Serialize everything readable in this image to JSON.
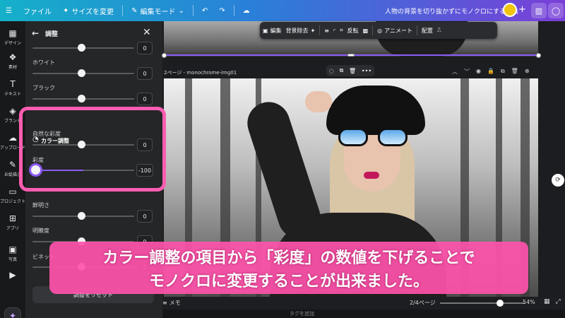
{
  "topbar": {
    "menu_icon": "hamburger-icon",
    "file_label": "ファイル",
    "resize_label": "サイズを変更",
    "edit_mode_label": "編集モード",
    "doc_title": "人物の背景を切り抜かずにモノクロにする方法"
  },
  "rail": {
    "items": [
      {
        "label": "デザイン",
        "icon": "design-icon"
      },
      {
        "label": "素材",
        "icon": "elements-icon"
      },
      {
        "label": "テキスト",
        "icon": "text-icon"
      },
      {
        "label": "ブランド",
        "icon": "brand-icon"
      },
      {
        "label": "アップロード",
        "icon": "upload-icon"
      },
      {
        "label": "お絵描き",
        "icon": "draw-icon"
      },
      {
        "label": "プロジェクト",
        "icon": "folder-icon"
      },
      {
        "label": "アプリ",
        "icon": "apps-icon"
      },
      {
        "label": "写真",
        "icon": "photo-icon"
      },
      {
        "label": "",
        "icon": "video-icon"
      }
    ]
  },
  "panel": {
    "title": "調整",
    "sliders_top": [
      {
        "label": "",
        "value": 0
      },
      {
        "label": "ホワイト",
        "value": 0
      },
      {
        "label": "ブラック",
        "value": 0
      }
    ],
    "color_section_title": "カラー調整",
    "color_sliders": [
      {
        "label": "自然な彩度",
        "value": 0
      },
      {
        "label": "彩度",
        "value": -100
      }
    ],
    "sliders_bottom": [
      {
        "label": "鮮明さ",
        "value": 0
      },
      {
        "label": "明瞭度",
        "value": 0
      },
      {
        "label": "ビネット",
        "value": 0
      }
    ],
    "reset_label": "調整をリセット"
  },
  "floating_toolbar": {
    "edit_label": "編集",
    "bg_remove_label": "背景除去",
    "flip_label": "反転",
    "animate_label": "アニメート",
    "position_label": "配置"
  },
  "canvas": {
    "page_label": "2ページ - monochrome-img01"
  },
  "caption": {
    "line1": "カラー調整の項目から「彩度」の数値を下げることで",
    "line2": "モノクロに変更することが出来ました。"
  },
  "bottombar": {
    "memo_label": "メモ",
    "pages": "2/4ページ",
    "zoom": "54%",
    "zoom_level": 0.54,
    "tag_hint": "タグを追加"
  },
  "colors": {
    "accent": "#8b5cf6",
    "highlight": "#ff5db1",
    "caption_bg": "#ff52ab"
  }
}
